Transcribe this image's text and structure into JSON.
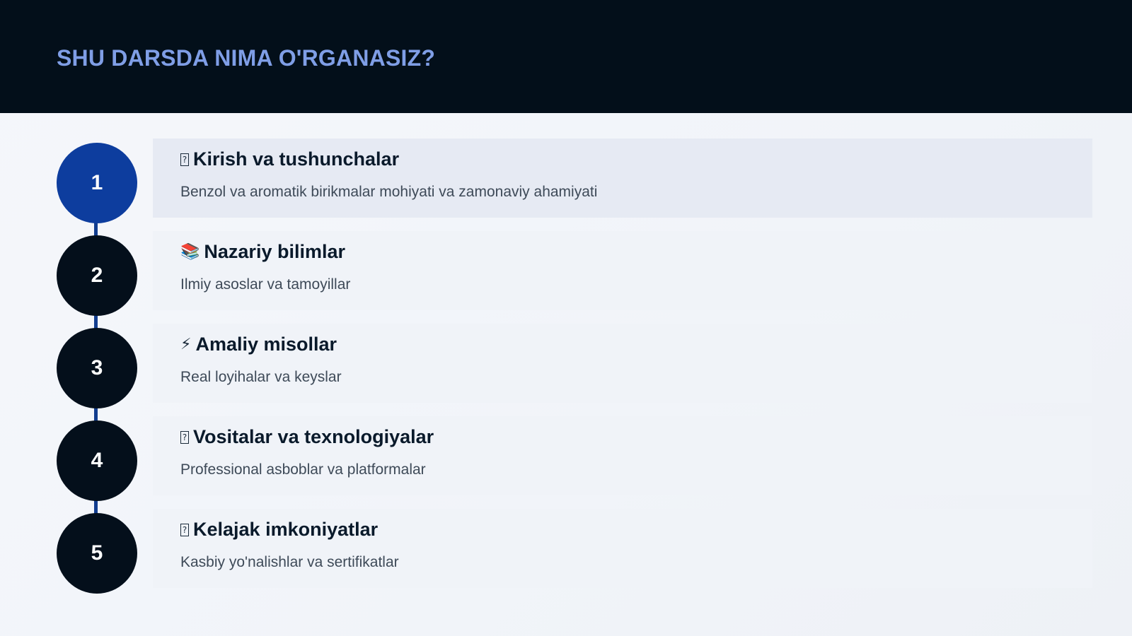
{
  "header": {
    "title": "SHU DARSDA NIMA O'RGANASIZ?"
  },
  "steps": [
    {
      "number": "1",
      "icon": "box-icon",
      "icon_glyph": "?",
      "title": "Kirish va tushunchalar",
      "description": "Benzol va aromatik birikmalar mohiyati va zamonaviy ahamiyati",
      "active": true
    },
    {
      "number": "2",
      "icon": "books-icon",
      "icon_glyph": "📚",
      "title": "Nazariy bilimlar",
      "description": "Ilmiy asoslar va tamoyillar",
      "active": false
    },
    {
      "number": "3",
      "icon": "lightning-icon",
      "icon_glyph": "⚡",
      "title": "Amaliy misollar",
      "description": "Real loyihalar va keyslar",
      "active": false
    },
    {
      "number": "4",
      "icon": "box-icon",
      "icon_glyph": "?",
      "title": "Vositalar va texnologiyalar",
      "description": "Professional asboblar va platformalar",
      "active": false
    },
    {
      "number": "5",
      "icon": "box-icon",
      "icon_glyph": "?",
      "title": "Kelajak imkoniyatlar",
      "description": "Kasbiy yo'nalishlar va sertifikatlar",
      "active": false
    }
  ],
  "colors": {
    "header_bg": "#030f1a",
    "title_accent": "#7f9ee6",
    "active_circle": "#0d3d9e",
    "circle": "#040f1b"
  }
}
